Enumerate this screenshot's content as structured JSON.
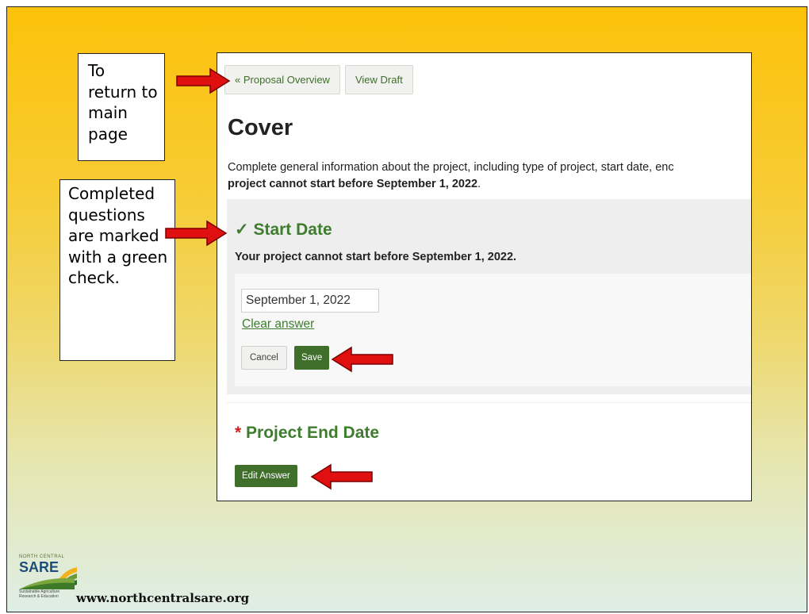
{
  "callouts": {
    "return_text": "To return to main page",
    "check_text": "Completed questions are marked with a green check."
  },
  "nav": {
    "overview_label": "« Proposal Overview",
    "draft_label": "View Draft"
  },
  "page": {
    "title": "Cover",
    "intro_line1": "Complete general information about the project, including type of project, start date, enc",
    "intro_line2_bold": "project cannot start before September 1, 2022",
    "intro_line2_end": "."
  },
  "start_date": {
    "check_mark": "✓",
    "title": "Start Date",
    "note": "Your project cannot start before September 1, 2022.",
    "value": "September 1, 2022",
    "clear_label": "Clear answer",
    "cancel_label": "Cancel",
    "save_label": "Save"
  },
  "end_date": {
    "required_mark": "*",
    "title": "Project End Date",
    "edit_label": "Edit Answer"
  },
  "footer": {
    "logo_top": "NORTH CENTRAL",
    "logo_main": "SARE",
    "logo_tagline": "Sustainable Agriculture Research & Education",
    "website": "www.northcentralsare.org"
  },
  "colors": {
    "accent_green": "#3e7d2e",
    "button_green": "#3f6f2a",
    "arrow_red": "#e01010",
    "required_red": "#d21f1f"
  }
}
